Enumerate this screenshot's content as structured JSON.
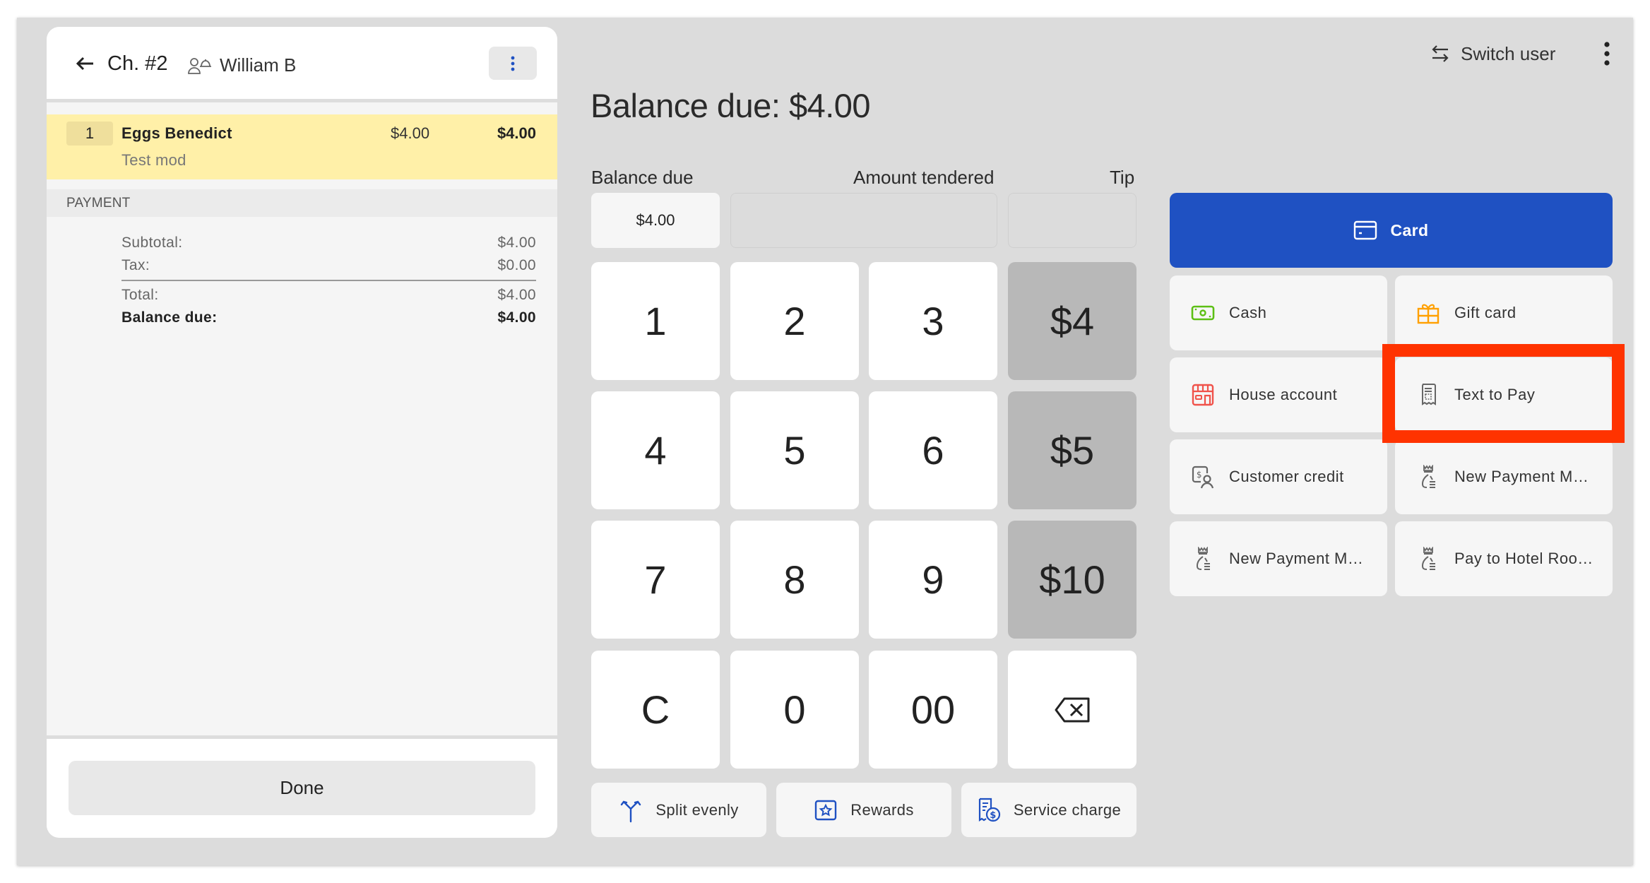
{
  "check": {
    "title": "Ch. #2",
    "guest": "William B",
    "items": [
      {
        "qty": "1",
        "name": "Eggs Benedict",
        "unit_price": "$4.00",
        "total": "$4.00",
        "modifier": "Test mod"
      }
    ],
    "payment_header": "PAYMENT",
    "summary": {
      "subtotal_label": "Subtotal:",
      "subtotal": "$4.00",
      "tax_label": "Tax:",
      "tax": "$0.00",
      "total_label": "Total:",
      "total": "$4.00",
      "balance_label": "Balance due:",
      "balance": "$4.00"
    },
    "done_label": "Done"
  },
  "header": {
    "switch_user_label": "Switch user"
  },
  "main": {
    "balance_title": "Balance due: $4.00",
    "fields": {
      "balance_due_label": "Balance due",
      "balance_due_value": "$4.00",
      "amount_tendered_label": "Amount tendered",
      "amount_tendered_value": "",
      "tip_label": "Tip",
      "tip_value": ""
    },
    "keypad": [
      "1",
      "2",
      "3",
      "$4",
      "4",
      "5",
      "6",
      "$5",
      "7",
      "8",
      "9",
      "$10",
      "C",
      "0",
      "00",
      "backspace"
    ],
    "actions": {
      "split_evenly": "Split evenly",
      "rewards": "Rewards",
      "service_charge": "Service charge"
    }
  },
  "payment_methods": {
    "card": "Card",
    "cash": "Cash",
    "gift_card": "Gift card",
    "house_account": "House account",
    "text_to_pay": "Text to Pay",
    "customer_credit": "Customer credit",
    "new_payment_1": "New Payment M…",
    "new_payment_2": "New Payment M…",
    "pay_to_hotel": "Pay to Hotel Roo…"
  },
  "colors": {
    "primary": "#1f51c2",
    "highlight": "#ff3300",
    "cash_icon": "#5cbf14",
    "gift_icon": "#ffa000",
    "house_icon": "#f0524a",
    "item_highlight": "#fff0a8"
  }
}
